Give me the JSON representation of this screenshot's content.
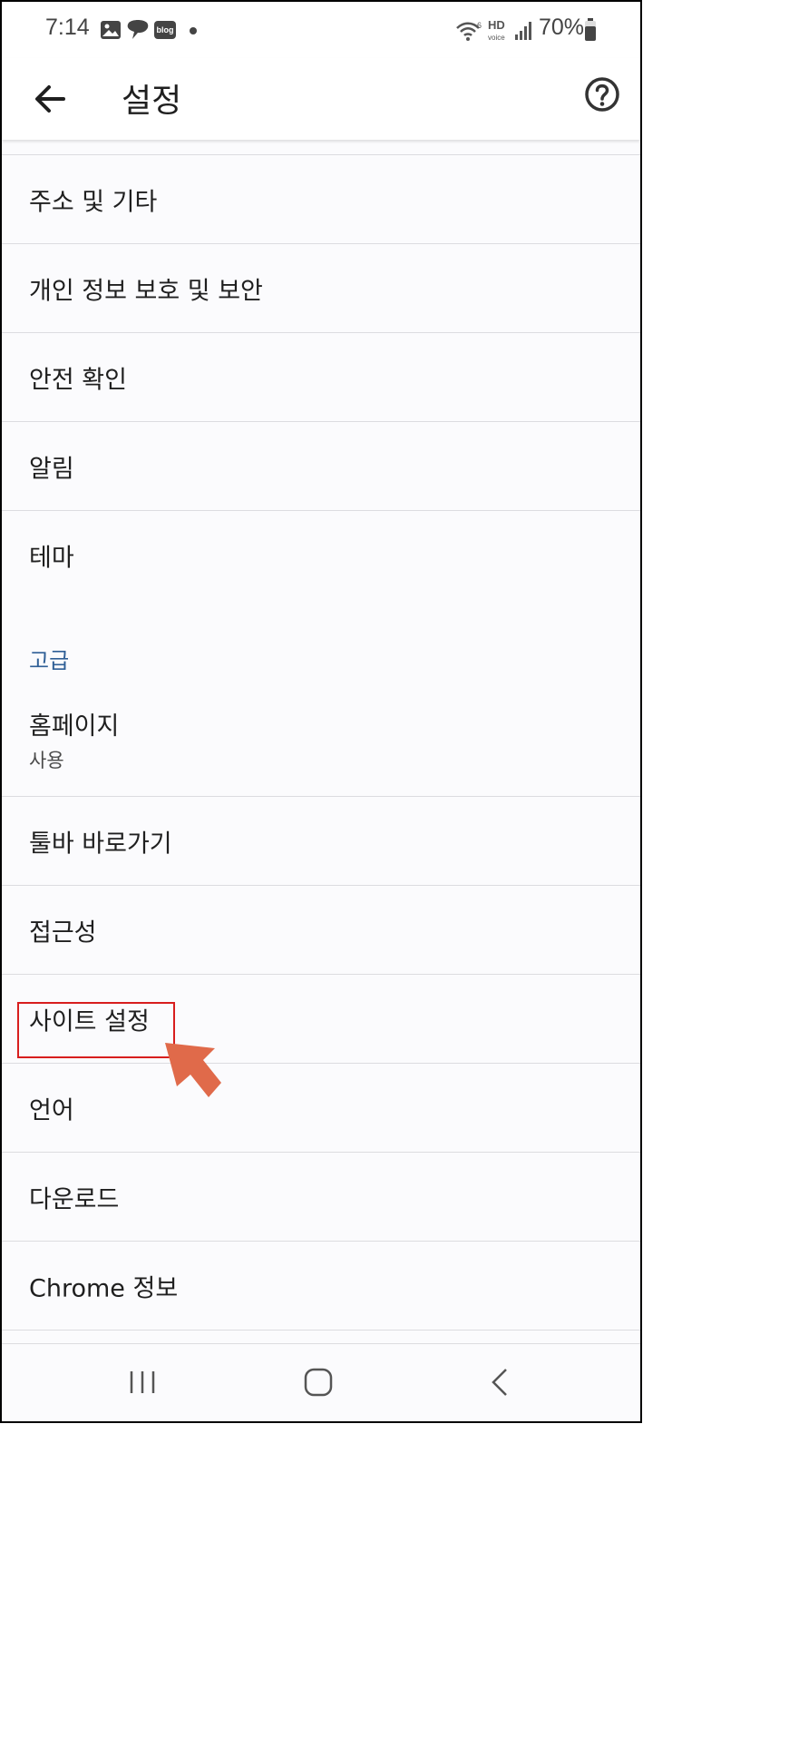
{
  "status_bar": {
    "time": "7:14",
    "blog_badge": "blog",
    "hd_label": "HD",
    "voice_label": "voice",
    "wifi_label": "6",
    "battery": "70%"
  },
  "app_bar": {
    "title": "설정"
  },
  "settings": {
    "address": "주소 및 기타",
    "privacy": "개인 정보 보호 및 보안",
    "safety_check": "안전 확인",
    "notifications": "알림",
    "theme": "테마",
    "advanced_header": "고급",
    "homepage": "홈페이지",
    "homepage_status": "사용",
    "toolbar_shortcut": "툴바 바로가기",
    "accessibility": "접근성",
    "site_settings": "사이트 설정",
    "languages": "언어",
    "downloads": "다운로드",
    "about_chrome": "Chrome 정보"
  },
  "colors": {
    "accent_header": "#2f5f96",
    "highlight_border": "#d81e1e",
    "arrow": "#e06a4a"
  }
}
